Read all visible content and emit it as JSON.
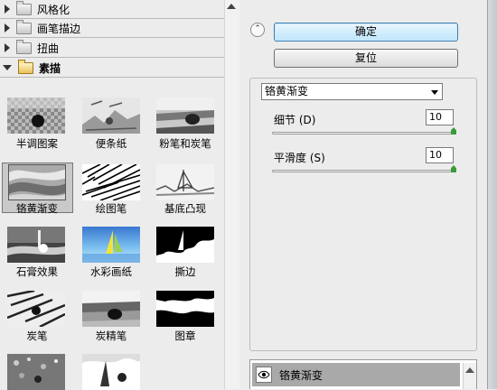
{
  "categories": [
    {
      "label": "风格化",
      "expanded": false,
      "icon": "folder-icon"
    },
    {
      "label": "画笔描边",
      "expanded": false,
      "icon": "folder-icon"
    },
    {
      "label": "扭曲",
      "expanded": false,
      "icon": "folder-icon"
    },
    {
      "label": "素描",
      "expanded": true,
      "icon": "folder-open-icon"
    }
  ],
  "filters": [
    {
      "label": "半调图案"
    },
    {
      "label": "便条纸"
    },
    {
      "label": "粉笔和炭笔"
    },
    {
      "label": "铬黄渐变",
      "selected": true
    },
    {
      "label": "绘图笔"
    },
    {
      "label": "基底凸现"
    },
    {
      "label": "石膏效果"
    },
    {
      "label": "水彩画纸"
    },
    {
      "label": "撕边"
    },
    {
      "label": "炭笔"
    },
    {
      "label": "炭精笔"
    },
    {
      "label": "图章"
    }
  ],
  "buttons": {
    "ok": "确定",
    "reset": "复位"
  },
  "settings": {
    "filter_name": "铬黄渐变",
    "detail": {
      "label": "细节 (D)",
      "value": "10",
      "level": 1.0
    },
    "smoothness": {
      "label": "平滑度 (S)",
      "value": "10",
      "level": 1.0
    }
  },
  "layers": {
    "name": "铬黄渐变",
    "icon": "eye-icon"
  },
  "colors": {
    "accent_button": "#bee6fd",
    "slider_knob": "#3a9a3a",
    "selection": "#c9c9c9"
  }
}
